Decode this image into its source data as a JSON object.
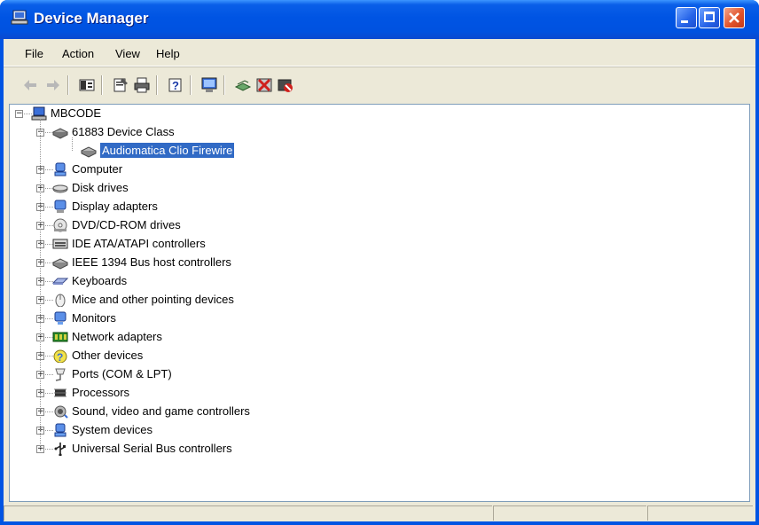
{
  "window": {
    "title": "Device Manager"
  },
  "menu": {
    "items": [
      "File",
      "Action",
      "View",
      "Help"
    ]
  },
  "tree": {
    "root": "MBCODE",
    "nodes": [
      {
        "label": "61883 Device Class",
        "icon": "device-class-icon",
        "expanded": true,
        "children": [
          {
            "label": "Audiomatica Clio Firewire",
            "icon": "firewire-device-icon",
            "selected": true
          }
        ]
      },
      {
        "label": "Computer",
        "icon": "computer-icon"
      },
      {
        "label": "Disk drives",
        "icon": "disk-drive-icon"
      },
      {
        "label": "Display adapters",
        "icon": "display-adapter-icon"
      },
      {
        "label": "DVD/CD-ROM drives",
        "icon": "cdrom-icon"
      },
      {
        "label": "IDE ATA/ATAPI controllers",
        "icon": "ide-controller-icon"
      },
      {
        "label": "IEEE 1394 Bus host controllers",
        "icon": "firewire-controller-icon"
      },
      {
        "label": "Keyboards",
        "icon": "keyboard-icon"
      },
      {
        "label": "Mice and other pointing devices",
        "icon": "mouse-icon"
      },
      {
        "label": "Monitors",
        "icon": "monitor-icon"
      },
      {
        "label": "Network adapters",
        "icon": "network-adapter-icon"
      },
      {
        "label": "Other devices",
        "icon": "unknown-device-icon"
      },
      {
        "label": "Ports (COM & LPT)",
        "icon": "port-icon"
      },
      {
        "label": "Processors",
        "icon": "processor-icon"
      },
      {
        "label": "Sound, video and game controllers",
        "icon": "sound-icon"
      },
      {
        "label": "System devices",
        "icon": "system-device-icon"
      },
      {
        "label": "Universal Serial Bus controllers",
        "icon": "usb-icon"
      }
    ]
  },
  "colors": {
    "titlebar": "#0054e3",
    "selection": "#316ac5",
    "chrome": "#ece9d8"
  }
}
